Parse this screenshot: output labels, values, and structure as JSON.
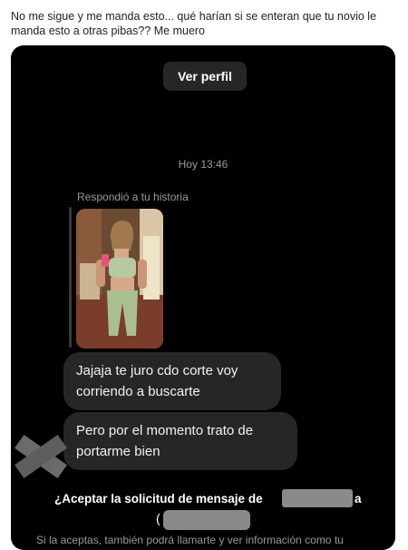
{
  "post": {
    "caption": "No me sigue y me manda esto... qué harían si se enteran que tu novio le manda esto a otras pibas?? Me muero"
  },
  "chat": {
    "view_profile_label": "Ver perfil",
    "timestamp": "Hoy 13:46",
    "story_reply_label": "Respondió a tu historia",
    "messages": [
      "Jajaja te juro cdo corte voy corriendo a buscarte",
      "Pero por el momento trato de portarme bien"
    ]
  },
  "request": {
    "title": "¿Aceptar la solicitud de mensaje de",
    "title_end": "a",
    "open_paren": "(",
    "subtitle": "Si la aceptas, también podrá llamarte y ver información como tu"
  },
  "colors": {
    "background": "#000000",
    "bubble": "#262626",
    "muted_text": "#9a9a9a",
    "redaction": "#8a8a8a",
    "x_mark": "#6b6b6b"
  },
  "icons": {
    "overlay_mark": "x-mark-icon"
  }
}
